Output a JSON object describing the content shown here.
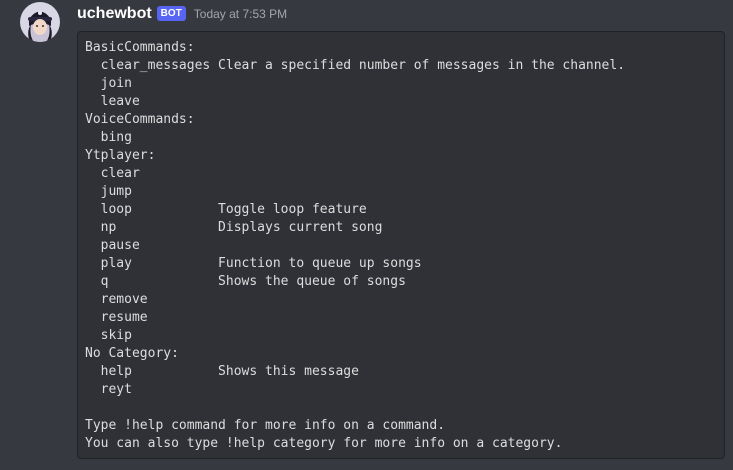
{
  "message": {
    "author": "uchewbot",
    "bot_tag": "BOT",
    "timestamp": "Today at 7:53 PM",
    "code_lines": [
      "BasicCommands:",
      "  clear_messages Clear a specified number of messages in the channel.",
      "  join",
      "  leave",
      "VoiceCommands:",
      "  bing",
      "Ytplayer:",
      "  clear",
      "  jump",
      "  loop           Toggle loop feature",
      "  np             Displays current song",
      "  pause",
      "  play           Function to queue up songs",
      "  q              Shows the queue of songs",
      "  remove",
      "  resume",
      "  skip",
      "No Category:",
      "  help           Shows this message",
      "  reyt",
      "",
      "Type !help command for more info on a command.",
      "You can also type !help category for more info on a category."
    ]
  },
  "colors": {
    "background": "#36393f",
    "codeblock_background": "#2f3136",
    "bot_tag": "#5865f2",
    "username": "#ffffff",
    "timestamp": "#a3a6aa",
    "code_text": "#dcddde"
  },
  "icons": {
    "avatar": "avatar-image"
  }
}
